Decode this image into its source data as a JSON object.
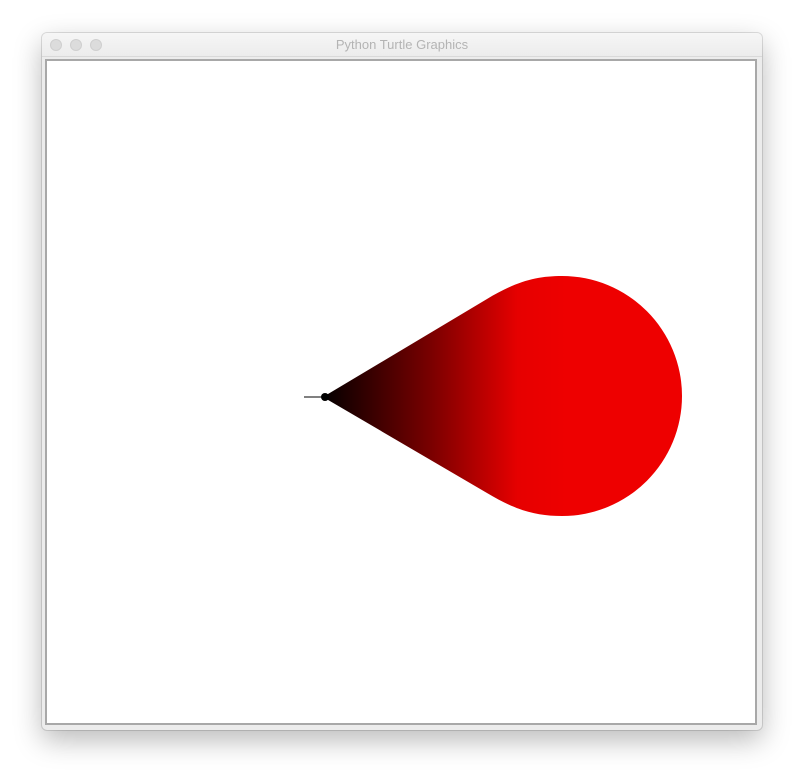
{
  "window": {
    "title": "Python Turtle Graphics"
  },
  "controls": {
    "close": "close-button",
    "minimize": "minimize-button",
    "zoom": "zoom-button"
  },
  "drawing": {
    "shape": "teardrop",
    "tip_color": "#000000",
    "body_color": "#ee0000",
    "background": "#ffffff",
    "turtle_cursor": "classic-arrow"
  }
}
